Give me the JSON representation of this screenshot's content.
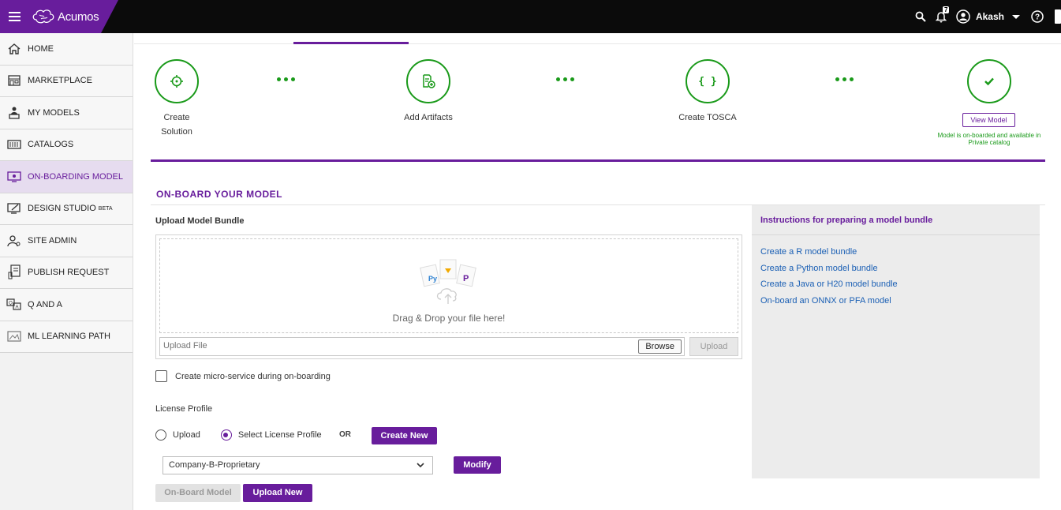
{
  "header": {
    "app_name": "Acumos",
    "user_name": "Akash",
    "notification_count": "7",
    "icons": [
      "menu-icon",
      "search-icon",
      "bell-icon",
      "user-avatar-icon",
      "chevron-down-icon",
      "help-icon"
    ],
    "brand_color": "#681d9c"
  },
  "sidebar": {
    "items": [
      {
        "label": "HOME",
        "icon": "home-icon"
      },
      {
        "label": "MARKETPLACE",
        "icon": "store-icon"
      },
      {
        "label": "MY MODELS",
        "icon": "person-desk-icon"
      },
      {
        "label": "CATALOGS",
        "icon": "catalog-icon"
      },
      {
        "label": "ON-BOARDING MODEL",
        "icon": "onboarding-icon",
        "active": true
      },
      {
        "label": "DESIGN STUDIO",
        "sup": "BETA",
        "icon": "design-icon"
      },
      {
        "label": "SITE ADMIN",
        "icon": "admin-icon"
      },
      {
        "label": "PUBLISH REQUEST",
        "icon": "publish-icon"
      },
      {
        "label": "Q AND A",
        "icon": "qa-icon"
      },
      {
        "label": "ML LEARNING PATH",
        "icon": "learning-icon"
      }
    ]
  },
  "steps": [
    {
      "label_line1": "Create",
      "label_line2": "Solution",
      "icon": "target-icon"
    },
    {
      "label_line1": "Add Artifacts",
      "icon": "add-file-icon"
    },
    {
      "label_line1": "Create TOSCA",
      "icon": "braces-icon"
    },
    {
      "icon": "check-icon"
    }
  ],
  "view_model_label": "View Model",
  "completion_note": "Model is on-boarded and available in Private catalog",
  "section_title": "ON-BOARD YOUR MODEL",
  "upload": {
    "heading": "Upload Model Bundle",
    "drop_text": "Drag & Drop your file here!",
    "file_placeholder": "Upload File",
    "browse_label": "Browse",
    "upload_label": "Upload"
  },
  "microservice_checkbox": "Create micro-service during on-boarding",
  "license": {
    "label": "License Profile",
    "option_upload": "Upload",
    "option_select": "Select License Profile",
    "or_text": "OR",
    "create_new_label": "Create New",
    "selected_profile": "Company-B-Proprietary",
    "modify_label": "Modify"
  },
  "actions": {
    "onboard_label": "On-Board Model",
    "upload_new_label": "Upload New"
  },
  "instructions": {
    "title": "Instructions for preparing a model bundle",
    "links": [
      "Create a R model bundle",
      "Create a Python model bundle",
      "Create a Java or H20 model bundle",
      "On-board an ONNX or PFA model"
    ]
  }
}
